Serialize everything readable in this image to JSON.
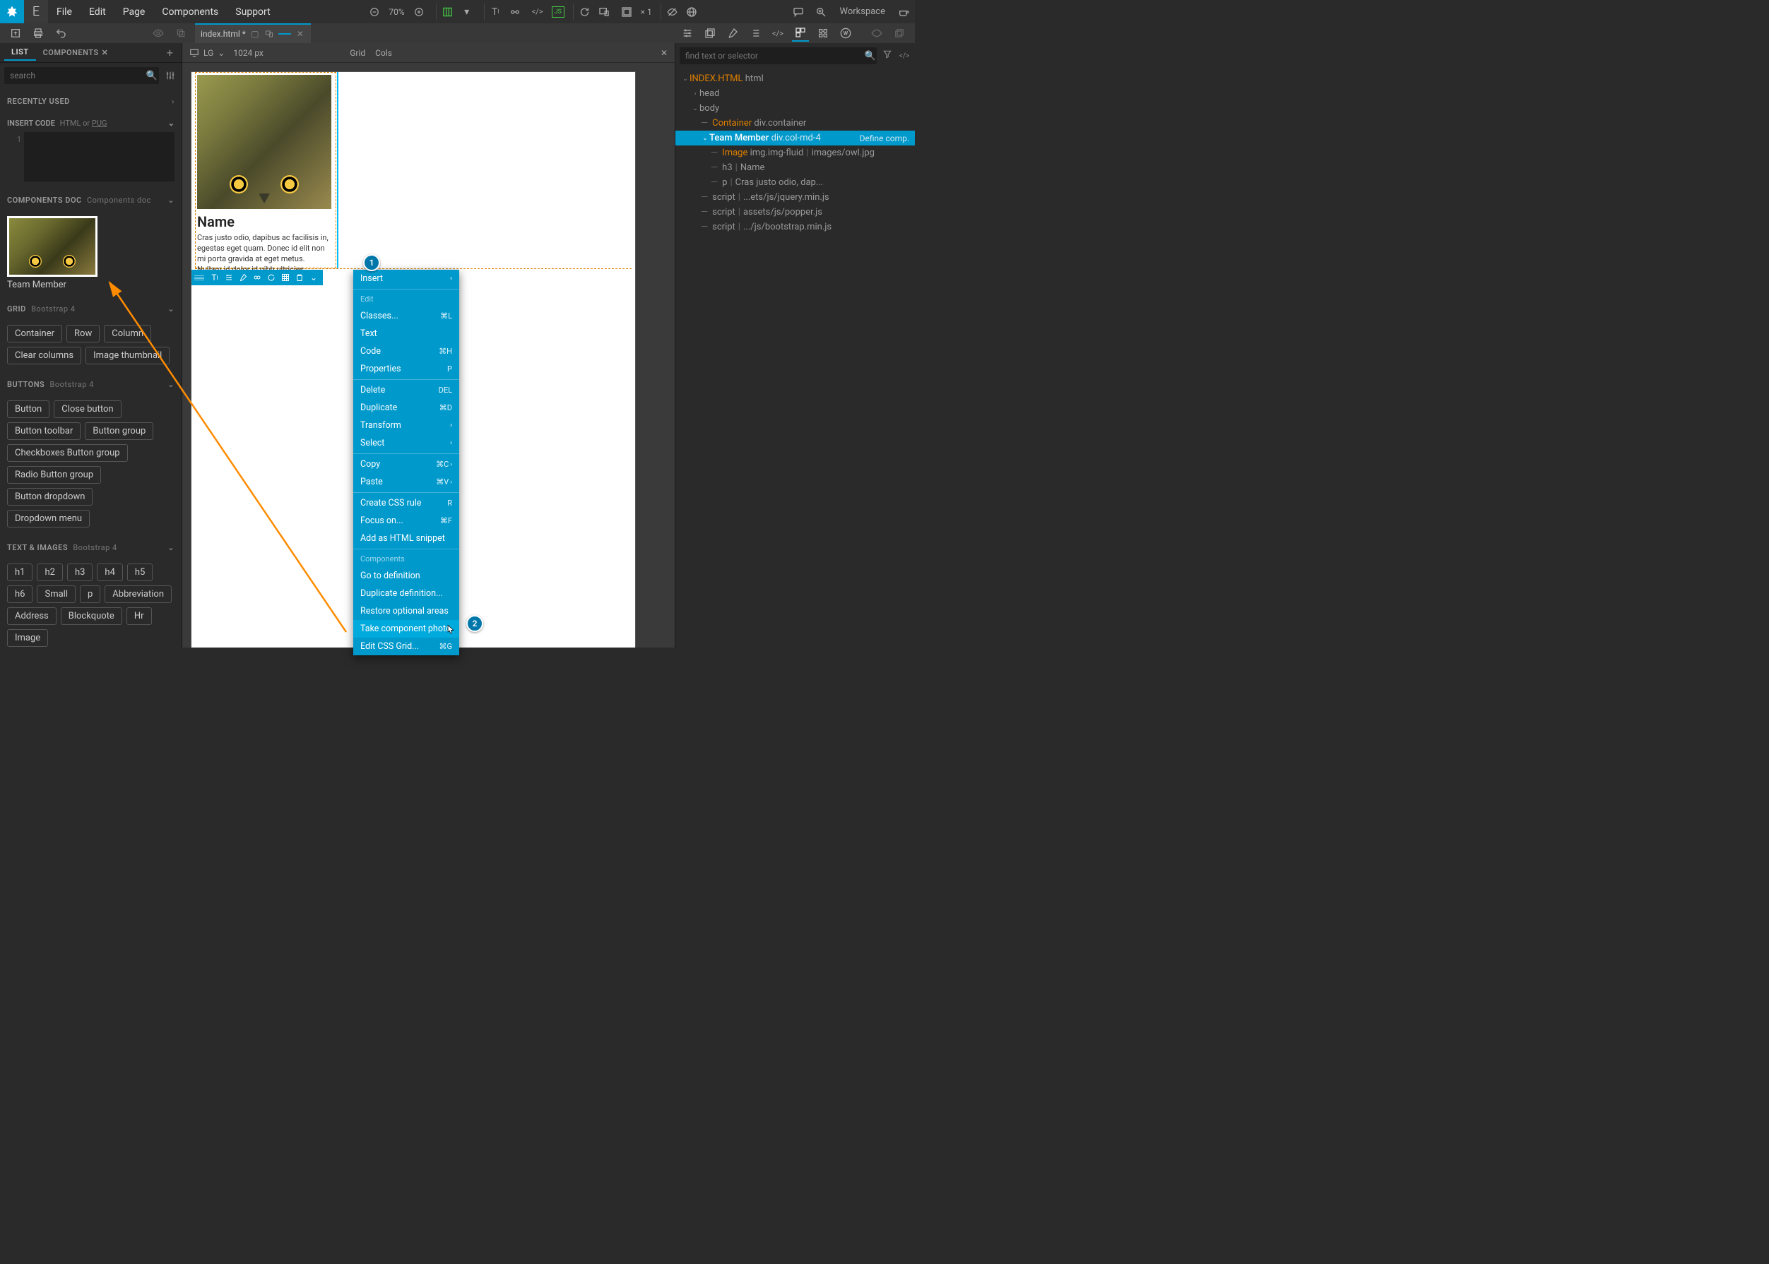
{
  "menubar": {
    "items": [
      "File",
      "Edit",
      "Page",
      "Components",
      "Support"
    ],
    "zoom": "70%",
    "multiplier": "× 1",
    "workspace": "Workspace"
  },
  "file_tab": {
    "name": "index.html *"
  },
  "center_top": {
    "breakpoint": "LG",
    "width": "1024 px",
    "grid": "Grid",
    "cols": "Cols"
  },
  "left": {
    "tabs": {
      "list": "LIST",
      "components": "COMPONENTS"
    },
    "search_placeholder": "search",
    "recently_used": "RECENTLY USED",
    "insert_code": "INSERT CODE",
    "insert_code_sub_a": "HTML or ",
    "insert_code_sub_b": "PUG",
    "code_line": "1",
    "components_doc": "COMPONENTS DOC",
    "components_doc_sub": "Components doc",
    "thumb_label": "Team Member",
    "grid": "GRID",
    "grid_sub": "Bootstrap 4",
    "grid_chips": [
      "Container",
      "Row",
      "Column",
      "Clear columns",
      "Image thumbnail"
    ],
    "buttons": "BUTTONS",
    "buttons_sub": "Bootstrap 4",
    "buttons_chips": [
      "Button",
      "Close button",
      "Button toolbar",
      "Button group",
      "Checkboxes Button group",
      "Radio Button group",
      "Button dropdown",
      "Dropdown menu"
    ],
    "text_images": "TEXT & IMAGES",
    "text_images_sub": "Bootstrap 4",
    "text_chips": [
      "h1",
      "h2",
      "h3",
      "h4",
      "h5",
      "h6",
      "Small",
      "p",
      "Abbreviation",
      "Address",
      "Blockquote",
      "Hr",
      "Image"
    ]
  },
  "card": {
    "title": "Name",
    "body": "Cras justo odio, dapibus ac facilisis in, egestas eget quam. Donec id elit non mi porta gravida at eget metus. Nullam id dolor id nibh ultricies vehicula ut id elit."
  },
  "ctx": {
    "insert": "Insert",
    "edit_head": "Edit",
    "classes": "Classes...",
    "classes_k": "⌘L",
    "text": "Text",
    "code": "Code",
    "code_k": "⌘H",
    "properties": "Properties",
    "properties_k": "P",
    "delete": "Delete",
    "delete_k": "DEL",
    "duplicate": "Duplicate",
    "duplicate_k": "⌘D",
    "transform": "Transform",
    "select": "Select",
    "copy": "Copy",
    "copy_k": "⌘C",
    "paste": "Paste",
    "paste_k": "⌘V",
    "create_css": "Create CSS rule",
    "create_css_k": "R",
    "focus": "Focus on...",
    "focus_k": "⌘F",
    "add_snippet": "Add as HTML snippet",
    "components_head": "Components",
    "goto_def": "Go to definition",
    "dup_def": "Duplicate definition...",
    "restore": "Restore optional areas",
    "take_photo": "Take component photo",
    "edit_grid": "Edit CSS Grid...",
    "edit_grid_k": "⌘G"
  },
  "badges": {
    "one": "1",
    "two": "2"
  },
  "right": {
    "search_placeholder": "find text or selector",
    "tree": {
      "root": "INDEX.HTML",
      "root_tag": "html",
      "head": "head",
      "body": "body",
      "container_name": "Container",
      "container_tag": "div.container",
      "team_name": "Team Member",
      "team_tag": "div.col-md-4",
      "team_action": "Define comp.",
      "image_name": "Image",
      "image_tag": "img.img-fluid",
      "image_path": "images/owl.jpg",
      "h3_tag": "h3",
      "h3_text": "Name",
      "p_tag": "p",
      "p_text": "Cras justo odio, dap...",
      "script1": "script",
      "script1_t": "...ets/js/jquery.min.js",
      "script2": "script",
      "script2_t": "assets/js/popper.js",
      "script3": "script",
      "script3_t": ".../js/bootstrap.min.js"
    }
  }
}
